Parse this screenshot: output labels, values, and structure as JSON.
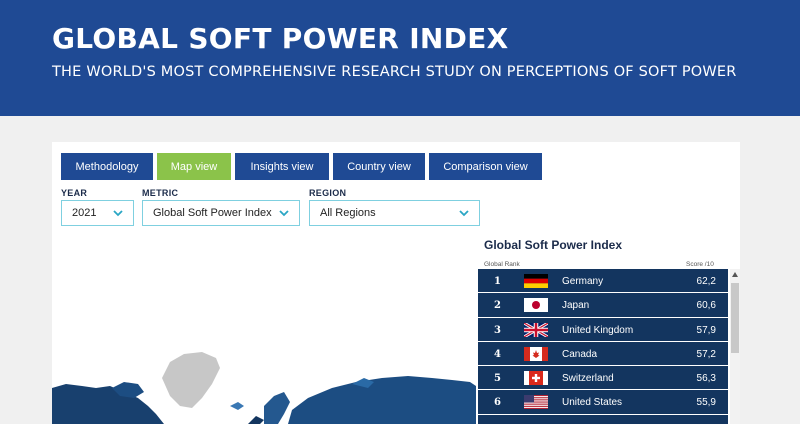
{
  "hero": {
    "title": "GLOBAL SOFT POWER INDEX",
    "subtitle": "THE WORLD'S MOST COMPREHENSIVE RESEARCH STUDY ON PERCEPTIONS OF SOFT POWER"
  },
  "tabs": [
    {
      "label": "Methodology",
      "active": false
    },
    {
      "label": "Map view",
      "active": true
    },
    {
      "label": "Insights view",
      "active": false
    },
    {
      "label": "Country view",
      "active": false
    },
    {
      "label": "Comparison view",
      "active": false
    }
  ],
  "filters": {
    "year": {
      "label": "YEAR",
      "value": "2021"
    },
    "metric": {
      "label": "METRIC",
      "value": "Global Soft Power Index"
    },
    "region": {
      "label": "REGION",
      "value": "All Regions"
    }
  },
  "ranking": {
    "title": "Global Soft Power Index",
    "rank_header": "Global Rank",
    "score_header": "Score /10",
    "rows": [
      {
        "rank": "1",
        "country": "Germany",
        "score": "62,2",
        "flag": "germany-flag-icon"
      },
      {
        "rank": "2",
        "country": "Japan",
        "score": "60,6",
        "flag": "japan-flag-icon"
      },
      {
        "rank": "3",
        "country": "United Kingdom",
        "score": "57,9",
        "flag": "uk-flag-icon"
      },
      {
        "rank": "4",
        "country": "Canada",
        "score": "57,2",
        "flag": "canada-flag-icon"
      },
      {
        "rank": "5",
        "country": "Switzerland",
        "score": "56,3",
        "flag": "switzerland-flag-icon"
      },
      {
        "rank": "6",
        "country": "United States",
        "score": "55,9",
        "flag": "usa-flag-icon"
      }
    ]
  },
  "colors": {
    "brand_blue": "#1f4a94",
    "active_tab": "#8bc34a",
    "ranking_row": "#13355f",
    "select_border": "#7fd0e0"
  }
}
